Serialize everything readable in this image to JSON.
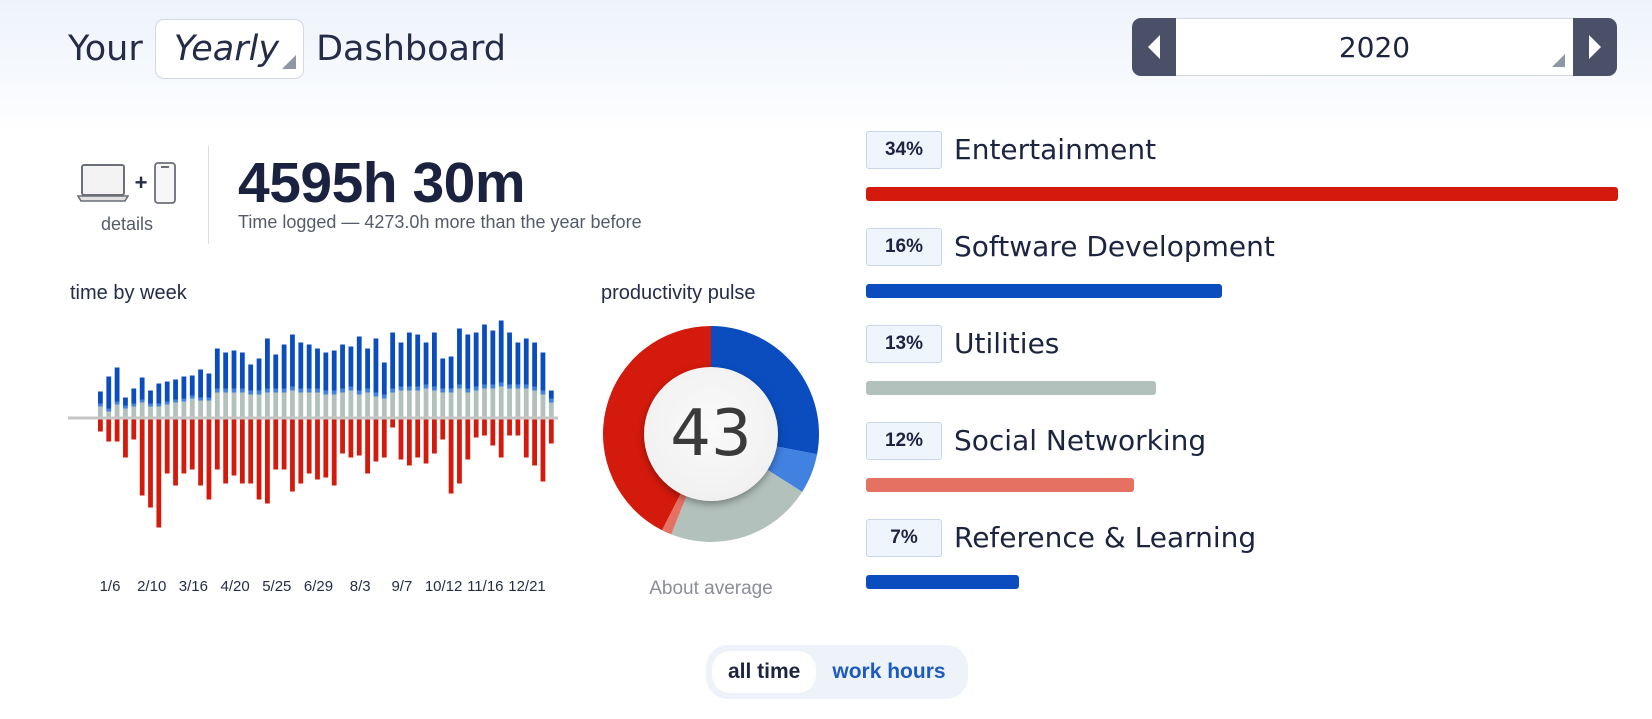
{
  "header": {
    "title_prefix": "Your",
    "period_value": "Yearly",
    "title_suffix": "Dashboard",
    "year": "2020"
  },
  "summary": {
    "devices_label": "details",
    "plus": "+",
    "total_time": "4595h 30m",
    "total_sub": "Time logged — 4273.0h more than the year before"
  },
  "colors": {
    "very_productive": "#0b4dbf",
    "productive": "#4182e0",
    "neutral": "#b3c1bd",
    "distracting": "#e57162",
    "very_distracting": "#d41a0c",
    "axis": "#c6c6c6"
  },
  "time_by_week": {
    "label": "time by week",
    "tick_labels": [
      "1/6",
      "2/10",
      "3/16",
      "4/20",
      "5/25",
      "6/29",
      "8/3",
      "9/7",
      "10/12",
      "11/16",
      "12/21"
    ],
    "chart_data": {
      "type": "bar",
      "stacked_diverging": true,
      "series": [
        {
          "key": "neutral",
          "values": [
            10,
            5,
            12,
            8,
            10,
            14,
            10,
            10,
            12,
            14,
            15,
            18,
            16,
            16,
            24,
            24,
            24,
            24,
            22,
            22,
            24,
            24,
            24,
            26,
            24,
            24,
            24,
            22,
            22,
            24,
            26,
            22,
            24,
            20,
            18,
            24,
            26,
            26,
            26,
            28,
            26,
            24,
            24,
            28,
            24,
            26,
            28,
            28,
            30,
            28,
            28,
            28,
            26,
            22,
            14
          ]
        },
        {
          "key": "productive",
          "values": [
            3,
            3,
            3,
            3,
            3,
            3,
            3,
            3,
            3,
            3,
            3,
            3,
            3,
            3,
            4,
            4,
            4,
            4,
            4,
            4,
            4,
            4,
            4,
            4,
            4,
            4,
            4,
            4,
            4,
            4,
            4,
            4,
            4,
            4,
            4,
            4,
            4,
            4,
            4,
            4,
            4,
            4,
            4,
            4,
            4,
            4,
            4,
            4,
            4,
            4,
            4,
            4,
            4,
            4,
            4
          ]
        },
        {
          "key": "very_productive",
          "values": [
            12,
            32,
            34,
            8,
            15,
            22,
            13,
            20,
            20,
            20,
            22,
            20,
            28,
            24,
            40,
            36,
            38,
            36,
            26,
            32,
            50,
            34,
            44,
            52,
            46,
            44,
            40,
            38,
            40,
            44,
            40,
            54,
            40,
            54,
            32,
            56,
            44,
            54,
            52,
            42,
            54,
            30,
            32,
            56,
            54,
            54,
            60,
            54,
            62,
            52,
            42,
            46,
            44,
            38,
            8
          ]
        },
        {
          "key": "distracting",
          "values": [
            0,
            0,
            0,
            0,
            0,
            0,
            0,
            0,
            0,
            0,
            0,
            0,
            0,
            0,
            0,
            0,
            0,
            0,
            0,
            0,
            0,
            0,
            0,
            0,
            0,
            0,
            0,
            0,
            0,
            0,
            0,
            0,
            0,
            0,
            0,
            0,
            0,
            0,
            0,
            0,
            0,
            0,
            0,
            0,
            0,
            0,
            0,
            0,
            0,
            0,
            0,
            0,
            0,
            0,
            0
          ]
        },
        {
          "key": "very_distracting",
          "values": [
            -12,
            -22,
            -22,
            -38,
            -20,
            -76,
            -88,
            -108,
            -54,
            -66,
            -54,
            -50,
            -66,
            -80,
            -50,
            -64,
            -56,
            -64,
            -64,
            -80,
            -84,
            -50,
            -50,
            -72,
            -64,
            -54,
            -60,
            -58,
            -66,
            -34,
            -38,
            -36,
            -54,
            -42,
            -38,
            -8,
            -40,
            -46,
            -38,
            -44,
            -34,
            -20,
            -74,
            -64,
            -40,
            -18,
            -16,
            -26,
            -38,
            -16,
            -16,
            -38,
            -46,
            -62,
            -24
          ]
        }
      ]
    }
  },
  "productivity_pulse": {
    "label": "productivity pulse",
    "score": "43",
    "caption": "About average",
    "chart_data": {
      "type": "pie",
      "donut": true,
      "slices": [
        {
          "key": "very_productive",
          "value": 28
        },
        {
          "key": "productive",
          "value": 6
        },
        {
          "key": "neutral",
          "value": 22
        },
        {
          "key": "distracting",
          "value": 1.5
        },
        {
          "key": "very_distracting",
          "value": 42.5
        }
      ]
    }
  },
  "categories": [
    {
      "pct": "34%",
      "name": "Entertainment",
      "fraction": 1.0,
      "color": "#d41a0c"
    },
    {
      "pct": "16%",
      "name": "Software Development",
      "fraction": 0.473,
      "color": "#0b4dbf"
    },
    {
      "pct": "13%",
      "name": "Utilities",
      "fraction": 0.385,
      "color": "#b3c1bd"
    },
    {
      "pct": "12%",
      "name": "Social Networking",
      "fraction": 0.357,
      "color": "#e57162"
    },
    {
      "pct": "7%",
      "name": "Reference & Learning",
      "fraction": 0.204,
      "color": "#0b4dbf"
    }
  ],
  "toggle": {
    "active_label": "all time",
    "inactive_label": "work hours"
  },
  "icons": {
    "laptop": "laptop-icon",
    "phone": "phone-icon",
    "prev": "chevron-left-icon",
    "next": "chevron-right-icon"
  }
}
